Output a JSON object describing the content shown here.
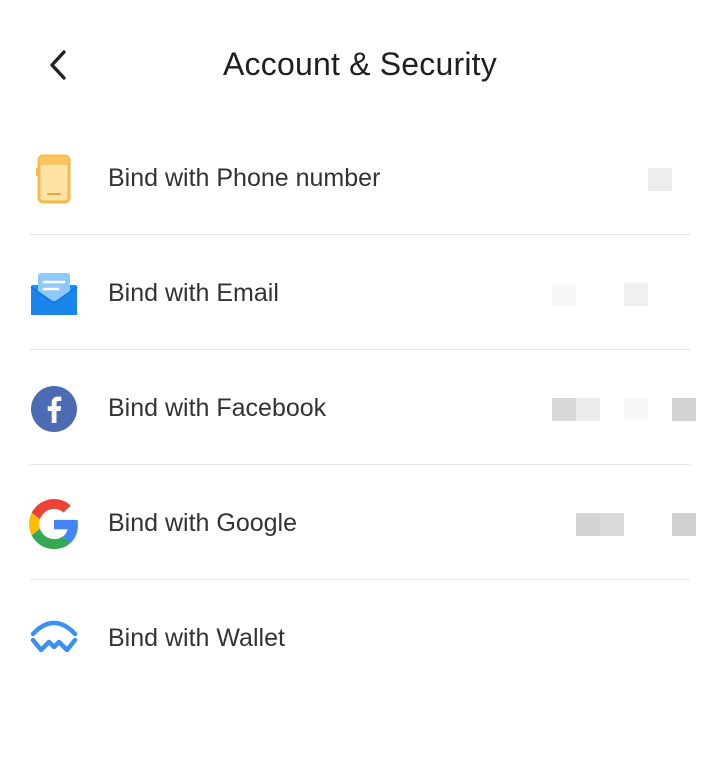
{
  "header": {
    "title": "Account & Security"
  },
  "icons": {
    "back": "chevron-left-icon",
    "phone": "smartphone-icon",
    "email": "mail-envelope-icon",
    "facebook": "facebook-icon",
    "google": "google-icon",
    "wallet": "wallet-icon"
  },
  "colors": {
    "phone_icon": "#f7c45e",
    "email_icon": "#1f8ff0",
    "facebook_icon": "#4b6bb3",
    "wallet_icon": "#3b8ff5",
    "divider": "#e6e6e6"
  },
  "items": [
    {
      "label": "Bind with Phone number"
    },
    {
      "label": "Bind with Email"
    },
    {
      "label": "Bind with Facebook"
    },
    {
      "label": "Bind with Google"
    },
    {
      "label": "Bind with Wallet"
    }
  ]
}
